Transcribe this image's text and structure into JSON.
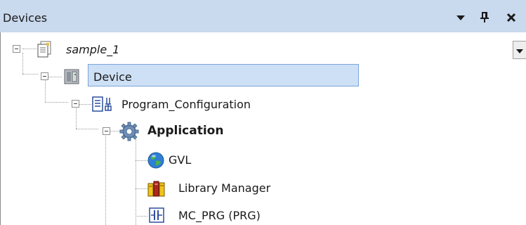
{
  "panel": {
    "title": "Devices",
    "controls": {
      "menu_icon": "dropdown-arrow-icon",
      "pin_icon": "pin-icon",
      "close_icon": "close-icon"
    }
  },
  "tree": {
    "items": [
      {
        "label": "sample_1",
        "icon": "project-icon",
        "style": "italic"
      },
      {
        "label": "Device",
        "icon": "device-icon",
        "selected": true
      },
      {
        "label": "Program_Configuration",
        "icon": "plc-logic-icon"
      },
      {
        "label": "Application",
        "icon": "application-gear-icon",
        "style": "bold"
      },
      {
        "label": "GVL",
        "icon": "globe-icon"
      },
      {
        "label": "Library Manager",
        "icon": "library-books-icon"
      },
      {
        "label": "MC_PRG (PRG)",
        "icon": "program-icon"
      }
    ]
  },
  "colors": {
    "titlebar": "#c9d9ee",
    "selection": "#cde0f5",
    "selection_border": "#7aa5d9"
  }
}
